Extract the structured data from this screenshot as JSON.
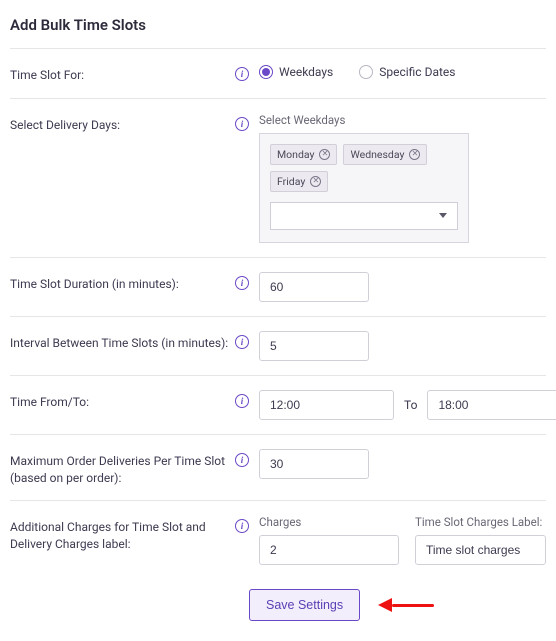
{
  "title": "Add Bulk Time Slots",
  "labels": {
    "time_slot_for": "Time Slot For:",
    "select_days": "Select Delivery Days:",
    "select_weekdays": "Select Weekdays",
    "duration": "Time Slot Duration (in minutes):",
    "interval": "Interval Between Time Slots (in minutes):",
    "time_from_to": "Time From/To:",
    "to": "To",
    "max_orders": "Maximum Order Deliveries Per Time Slot (based on per order):",
    "additional": "Additional Charges for Time Slot and Delivery Charges label:",
    "charges": "Charges",
    "charges_label": "Time Slot Charges Label:"
  },
  "radios": {
    "weekdays": "Weekdays",
    "specific": "Specific Dates"
  },
  "days": {
    "monday": "Monday",
    "wednesday": "Wednesday",
    "friday": "Friday"
  },
  "values": {
    "duration": "60",
    "interval": "5",
    "time_from": "12:00",
    "time_to": "18:00",
    "max_orders": "30",
    "charges": "2",
    "charges_label": "Time slot charges"
  },
  "buttons": {
    "save": "Save Settings"
  },
  "info_glyph": "i"
}
